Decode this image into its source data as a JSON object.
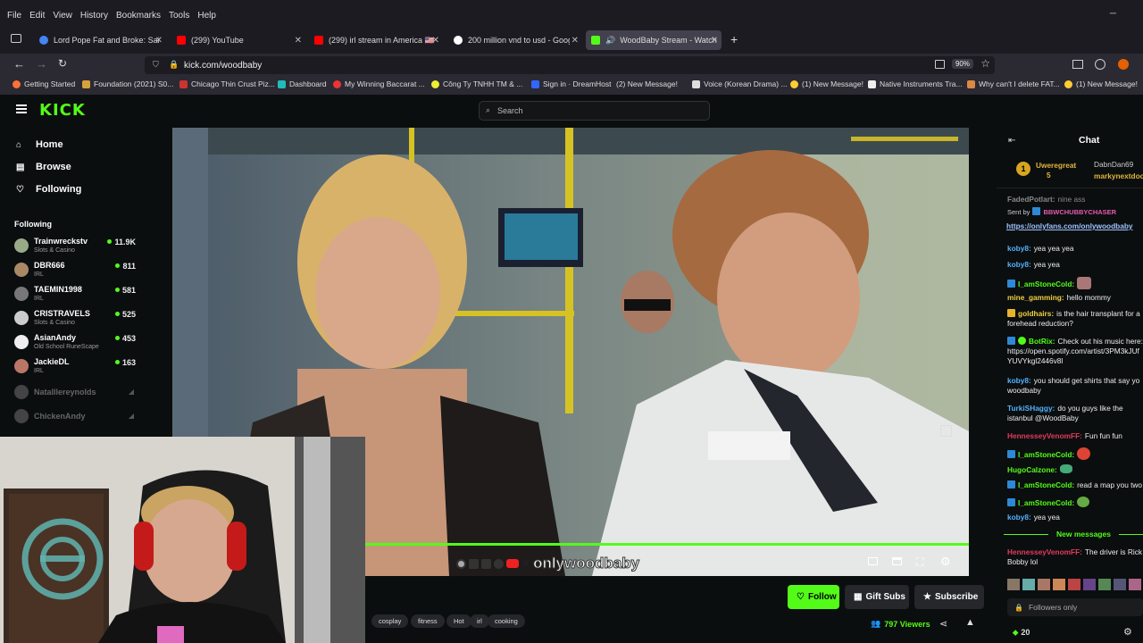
{
  "menu": [
    "File",
    "Edit",
    "View",
    "History",
    "Bookmarks",
    "Tools",
    "Help"
  ],
  "tabs": [
    {
      "title": "Lord Pope Fat and Broke: Saigo",
      "color": "#4285f4"
    },
    {
      "title": "(299) YouTube",
      "color": "#ff0000"
    },
    {
      "title": "(299) irl stream in America 🇺🇸 D",
      "color": "#ff0000"
    },
    {
      "title": "200 million vnd to usd - Googl",
      "color": "#4285f4"
    },
    {
      "title": "WoodBaby Stream - Watch",
      "color": "#53fc18"
    }
  ],
  "url": "kick.com/woodbaby",
  "zoom": "90%",
  "bookmarks": [
    "Getting Started",
    "Foundation (2021) S0...",
    "Chicago Thin Crust Piz...",
    "Dashboard",
    "My Winning Baccarat ...",
    "Công Ty TNHH TM & ...",
    "Sign in · DreamHost",
    "(2) New Message!",
    "Voice (Korean Drama) ...",
    "(1) New Message!",
    "Native Instruments Tra...",
    "Why can't I delete FAT...",
    "(1) New Message!"
  ],
  "site": {
    "logo": "KICK",
    "search_placeholder": "Search",
    "nav": [
      "Home",
      "Browse",
      "Following"
    ],
    "following_heading": "Following",
    "channels": [
      {
        "name": "Trainwreckstv",
        "category": "Slots & Casino",
        "viewers": "11.9K"
      },
      {
        "name": "DBR666",
        "category": "IRL",
        "viewers": "811"
      },
      {
        "name": "TAEMIN1998",
        "category": "IRL",
        "viewers": "581"
      },
      {
        "name": "CRISTRAVELS",
        "category": "Slots & Casino",
        "viewers": "525"
      },
      {
        "name": "AsianAndy",
        "category": "Old School RuneScape",
        "viewers": "453"
      },
      {
        "name": "JackieDL",
        "category": "IRL",
        "viewers": "163"
      }
    ],
    "offline_channels": [
      "Natalllereynolds",
      "ChickenAndy"
    ],
    "overlay_text": "onlywoodbaby",
    "actions": {
      "follow": "Follow",
      "gift": "Gift Subs",
      "subscribe": "Subscribe"
    },
    "tags": [
      "cosplay",
      "fitness",
      "Hot",
      "irl",
      "cooking"
    ],
    "viewers": "797 Viewers"
  },
  "chat": {
    "title": "Chat",
    "pinned_top": [
      {
        "user": "Uweregreat",
        "count": "5"
      },
      {
        "user": "DabnDan69"
      },
      {
        "user": "markynextdoo"
      }
    ],
    "messages": [
      {
        "user": "FadedPotlart:",
        "text": "nine ass"
      },
      {
        "user": "Sent by",
        "text": "BBWCHUBBYCHASER"
      },
      {
        "user": "",
        "text": "https://onlyfans.com/onlywoodbaby"
      },
      {
        "user": "koby8:",
        "text": "yea yea yea"
      },
      {
        "user": "koby8:",
        "text": "yea yea"
      },
      {
        "user": "I_amStoneCold:",
        "text": ""
      },
      {
        "user": "mine_gamming:",
        "text": "hello mommy"
      },
      {
        "user": "goldhairs:",
        "text": "is the hair transplant for a forehead reduction?"
      },
      {
        "user": "BotRix:",
        "text": "Check out his music here: https://open.spotify.com/artist/3PM3kJUfYUVYkgl2446v8l"
      },
      {
        "user": "koby8:",
        "text": "you should get shirts that say yo woodbaby"
      },
      {
        "user": "TurkiSHaggy:",
        "text": "do you guys like the istanbul @WoodBaby"
      },
      {
        "user": "HennesseyVenomFF:",
        "text": "Fun fun fun"
      },
      {
        "user": "I_amStoneCold:",
        "text": ""
      },
      {
        "user": "HugoCalzone:",
        "text": ""
      },
      {
        "user": "I_amStoneCold:",
        "text": "read a map you two"
      },
      {
        "user": "I_amStoneCold:",
        "text": ""
      },
      {
        "user": "koby8:",
        "text": "yea yea"
      }
    ],
    "new_messages": "New messages",
    "last_message": {
      "user": "HennesseyVenomFF:",
      "text": "The driver is Rick Bobby lol"
    },
    "followers_only": "Followers only",
    "points": "20"
  }
}
